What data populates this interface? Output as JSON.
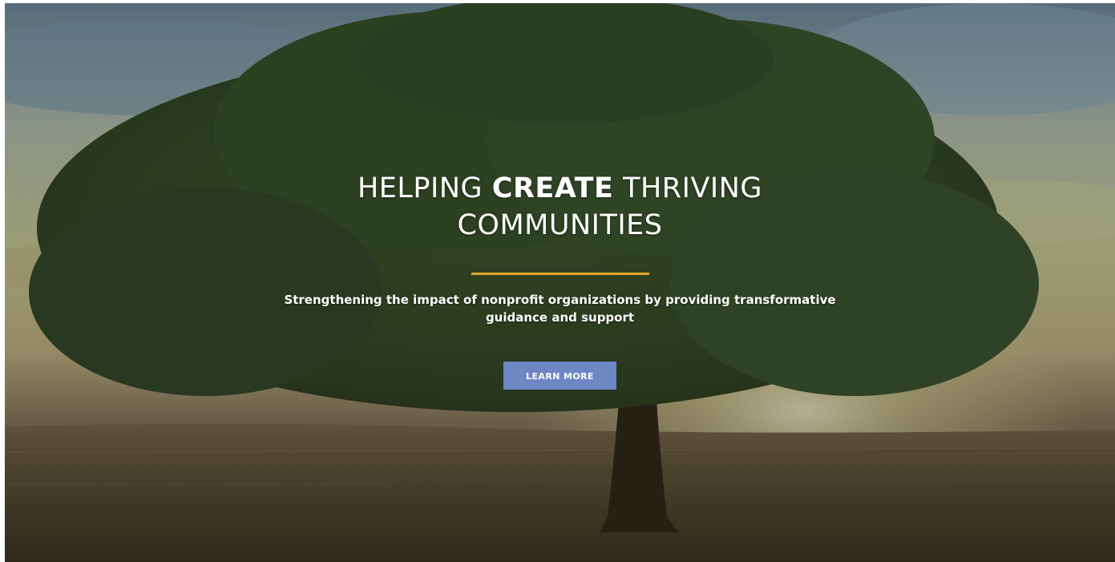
{
  "hero": {
    "headline_part1": "HELPING",
    "headline_bold": "CREATE",
    "headline_part2": "THRIVING COMMUNITIES",
    "subheading": "Strengthening the impact of nonprofit organizations by providing transformative guidance and support",
    "cta_label": "LEARN MORE"
  },
  "colors": {
    "accent_line": "#e0a82a",
    "button_bg": "#6d86c4",
    "text": "#ffffff"
  },
  "background": {
    "icon": "tree-landscape-photo"
  }
}
